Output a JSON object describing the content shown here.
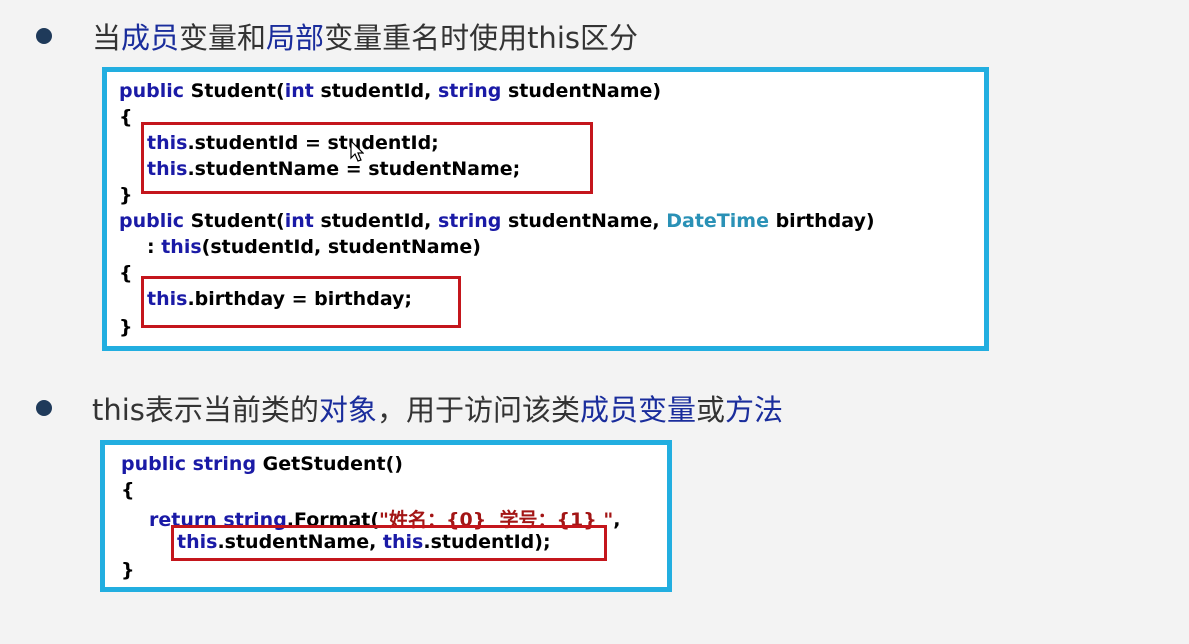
{
  "bullets": [
    {
      "segments": [
        {
          "text": "当",
          "hl": false
        },
        {
          "text": "成员",
          "hl": true
        },
        {
          "text": "变量和",
          "hl": false
        },
        {
          "text": "局部",
          "hl": true
        },
        {
          "text": "变量重名时使用this区分",
          "hl": false
        }
      ]
    },
    {
      "segments": [
        {
          "text": "this表示当前类的",
          "hl": false
        },
        {
          "text": "对象",
          "hl": true
        },
        {
          "text": "，用于访问该类",
          "hl": false
        },
        {
          "text": "成员变量",
          "hl": true
        },
        {
          "text": "或",
          "hl": false
        },
        {
          "text": "方法",
          "hl": true
        }
      ]
    }
  ],
  "code1": {
    "l1": {
      "kw1": "public",
      "t1": " Student(",
      "kw2": "int",
      "t2": " studentId, ",
      "kw3": "string",
      "t3": " studentName)"
    },
    "l2": "{",
    "l3": {
      "kw": "this",
      "t": ".studentId = studentId;"
    },
    "l4": {
      "kw": "this",
      "t": ".studentName = studentName;"
    },
    "l5": "}",
    "l6": {
      "kw1": "public",
      "t1": " Student(",
      "kw2": "int",
      "t2": " studentId, ",
      "kw3": "string",
      "t3": " studentName, ",
      "ty": "DateTime",
      "t4": " birthday)"
    },
    "l7": {
      "t1": ": ",
      "kw": "this",
      "t2": "(studentId, studentName)"
    },
    "l8": "{",
    "l9": {
      "kw": "this",
      "t": ".birthday = birthday;"
    },
    "l10": "}"
  },
  "code2": {
    "l1": {
      "kw1": "public",
      "sp": " ",
      "kw2": "string",
      "t": " GetStudent()"
    },
    "l2": "{",
    "l3": {
      "kw1": "return",
      "sp": " ",
      "kw2": "string",
      "t1": ".Format(",
      "str": "\"姓名：{0}  学号：{1} \"",
      "t2": ","
    },
    "l4": {
      "kw1": "this",
      "t1": ".studentName, ",
      "kw2": "this",
      "t2": ".studentId);"
    },
    "l5": "}"
  }
}
